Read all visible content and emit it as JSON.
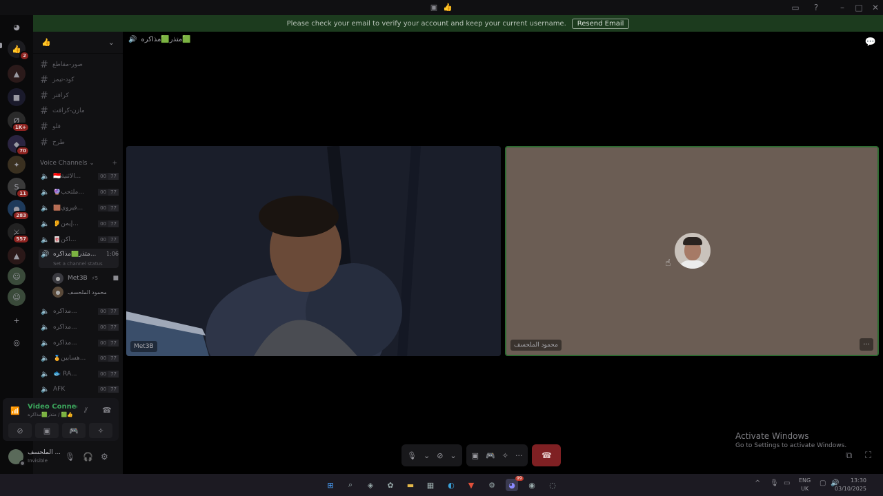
{
  "notice": {
    "message": "Please check your email to verify your account and keep your current username.",
    "button": "Resend Email"
  },
  "rail": {
    "badges": [
      "2",
      "1K+",
      "70",
      "11",
      "283",
      "557"
    ]
  },
  "sidebar": {
    "text_channels": [
      "صور-مقاطع",
      "كود-تيمز",
      "كرافتر",
      "مازن-كرافت",
      "فلو",
      "طرح"
    ],
    "voice_category": "Voice Channels",
    "voice_channels": [
      {
        "name": "🇮🇩الاثنية...",
        "c1": "00",
        "c2": "77"
      },
      {
        "name": "🔮ملتحب...",
        "c1": "00",
        "c2": "77"
      },
      {
        "name": "🟫فيروي...",
        "c1": "00",
        "c2": "77"
      },
      {
        "name": "👂إيمن...",
        "c1": "00",
        "c2": "77"
      },
      {
        "name": "🀄اكن...",
        "c1": "00",
        "c2": "77"
      }
    ],
    "active_channel": {
      "name": "متذر🟩مذاكره...",
      "time": "1:06",
      "status_hint": "Set a channel status"
    },
    "members": [
      {
        "name": "Met3B",
        "extra": "⚡5"
      },
      {
        "name": "محمود الملحسف"
      }
    ],
    "voice_channels_2": [
      {
        "name": "مذاكره...",
        "c1": "00",
        "c2": "77"
      },
      {
        "name": "مذاكره...",
        "c1": "00",
        "c2": "77"
      },
      {
        "name": "مذاكره...",
        "c1": "00",
        "c2": "77"
      },
      {
        "name": "🏅هسابين...",
        "c1": "00",
        "c2": "77"
      },
      {
        "name": "🐟 RA...",
        "c1": "00",
        "c2": "77"
      },
      {
        "name": "AFK",
        "c1": "00",
        "c2": "77"
      }
    ]
  },
  "voice_panel": {
    "title": "Video Connected",
    "subtitle": "متذر🟩مذاكره / 🟩👍"
  },
  "user": {
    "name": "الملحسف ...",
    "status": "Invisible"
  },
  "stage": {
    "channel_name": "متذر🟩مذاكره🟩",
    "tile1_label": "Met3B",
    "tile2_label": "محمود الملحسف"
  },
  "activate": {
    "line1": "Activate Windows",
    "line2": "Go to Settings to activate Windows."
  },
  "taskbar": {
    "lang1": "ENG",
    "lang2": "UK",
    "time": "13:30",
    "date": "03/10/2025",
    "discord_badge": "99"
  },
  "colors": {
    "notice_bg": "#1c3b1e",
    "connected_green": "#3ba55c",
    "hangup_red": "#7f2023",
    "badge_red": "#8e2320"
  }
}
